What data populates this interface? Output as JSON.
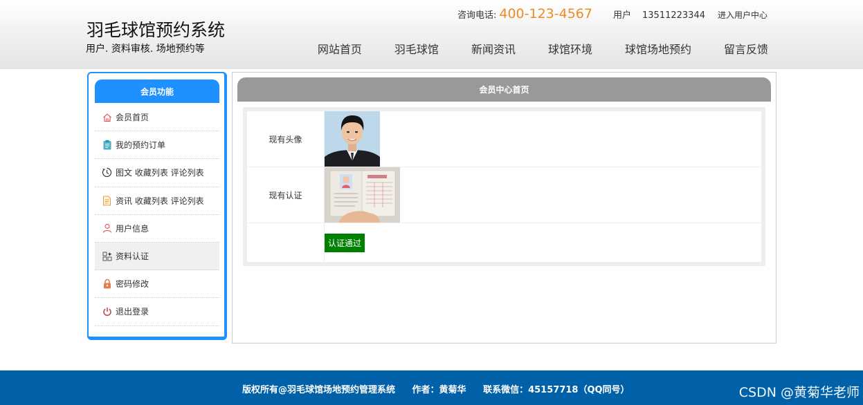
{
  "header": {
    "site_title": "羽毛球馆预约系统",
    "site_subtitle": "用户. 资料审核. 场地预约等",
    "phone_label": "咨询电话:",
    "phone_number": "400-123-4567",
    "user_label": "用户",
    "user_value": "13511223344",
    "user_center_link": "进入用户中心",
    "phone_color": "#f08a24"
  },
  "nav": [
    {
      "label": "网站首页"
    },
    {
      "label": "羽毛球馆"
    },
    {
      "label": "新闻资讯"
    },
    {
      "label": "球馆环境"
    },
    {
      "label": "球馆场地预约"
    },
    {
      "label": "留言反馈"
    }
  ],
  "sidebar": {
    "title": "会员功能",
    "accent_color": "#1e90ff",
    "items": [
      {
        "label": "会员首页",
        "icon": "home-icon"
      },
      {
        "label": "我的预约订单",
        "icon": "clipboard-icon"
      },
      {
        "label": "图文 收藏列表 评论列表",
        "icon": "clock-icon"
      },
      {
        "label": "资讯 收藏列表 评论列表",
        "icon": "document-icon"
      },
      {
        "label": "用户信息",
        "icon": "user-icon"
      },
      {
        "label": "资料认证",
        "icon": "grid-icon"
      },
      {
        "label": "密码修改",
        "icon": "lock-icon"
      },
      {
        "label": "退出登录",
        "icon": "power-icon"
      }
    ]
  },
  "main": {
    "title": "会员中心首页",
    "avatar_label": "现有头像",
    "cert_label": "现有认证",
    "verify_button": "认证通过",
    "verify_color": "#008000"
  },
  "footer": {
    "copyright": "版权所有@羽毛球馆场地预约管理系统",
    "author": "作者：黄菊华",
    "contact": "联系微信：45157718（QQ同号）",
    "watermark": "CSDN @黄菊华老师"
  }
}
